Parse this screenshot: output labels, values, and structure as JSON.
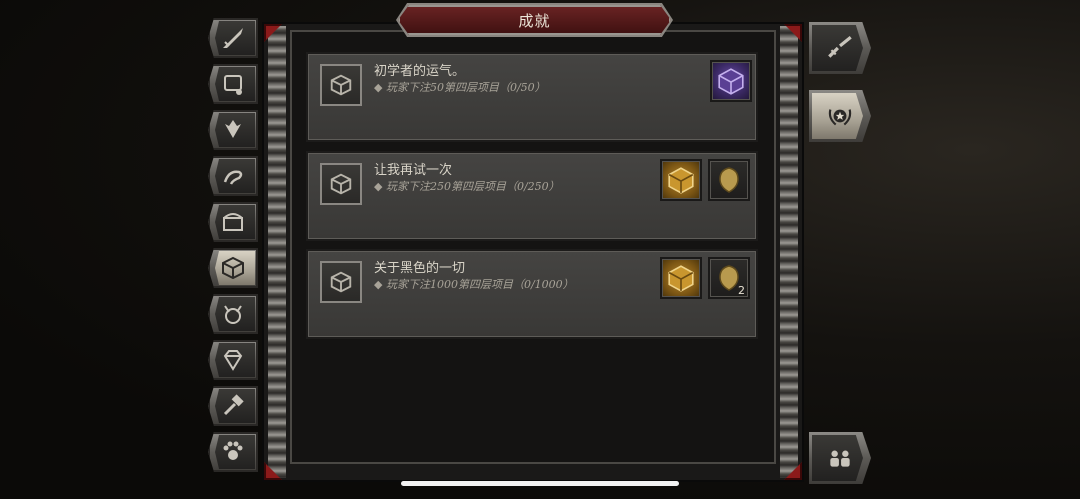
{
  "window": {
    "title": "成就"
  },
  "left_tabs": [
    {
      "icon": "sword-icon",
      "active": false
    },
    {
      "icon": "scroll-icon",
      "active": false
    },
    {
      "icon": "wings-icon",
      "active": false
    },
    {
      "icon": "dragon-icon",
      "active": false
    },
    {
      "icon": "chest-icon",
      "active": false
    },
    {
      "icon": "cube-icon",
      "active": true
    },
    {
      "icon": "demon-skull-icon",
      "active": false
    },
    {
      "icon": "gem-icon",
      "active": false
    },
    {
      "icon": "hammer-icon",
      "active": false
    },
    {
      "icon": "paw-icon",
      "active": false
    }
  ],
  "right_tabs": [
    {
      "icon": "broken-sword-icon",
      "active": false
    },
    {
      "icon": "laurel-medal-icon",
      "active": true
    },
    {
      "icon": "party-icon",
      "active": false
    }
  ],
  "achievements": [
    {
      "title": "初学者的运气。",
      "description": "◆ 玩家下注50第四层项目（0/50）",
      "rewards": [
        {
          "type": "purple-cube",
          "count": ""
        }
      ]
    },
    {
      "title": "让我再试一次",
      "description": "◆ 玩家下注250第四层项目（0/250）",
      "rewards": [
        {
          "type": "gold-cube",
          "count": ""
        },
        {
          "type": "shield",
          "count": ""
        }
      ]
    },
    {
      "title": "关于黑色的一切",
      "description": "◆ 玩家下注1000第四层项目（0/1000）",
      "rewards": [
        {
          "type": "gold-cube",
          "count": ""
        },
        {
          "type": "shield",
          "count": "2"
        }
      ]
    }
  ],
  "colors": {
    "banner": "#6b2424",
    "corner_red": "#8b1a1a",
    "row_bg": "#454442",
    "text": "#d9d4c8"
  }
}
